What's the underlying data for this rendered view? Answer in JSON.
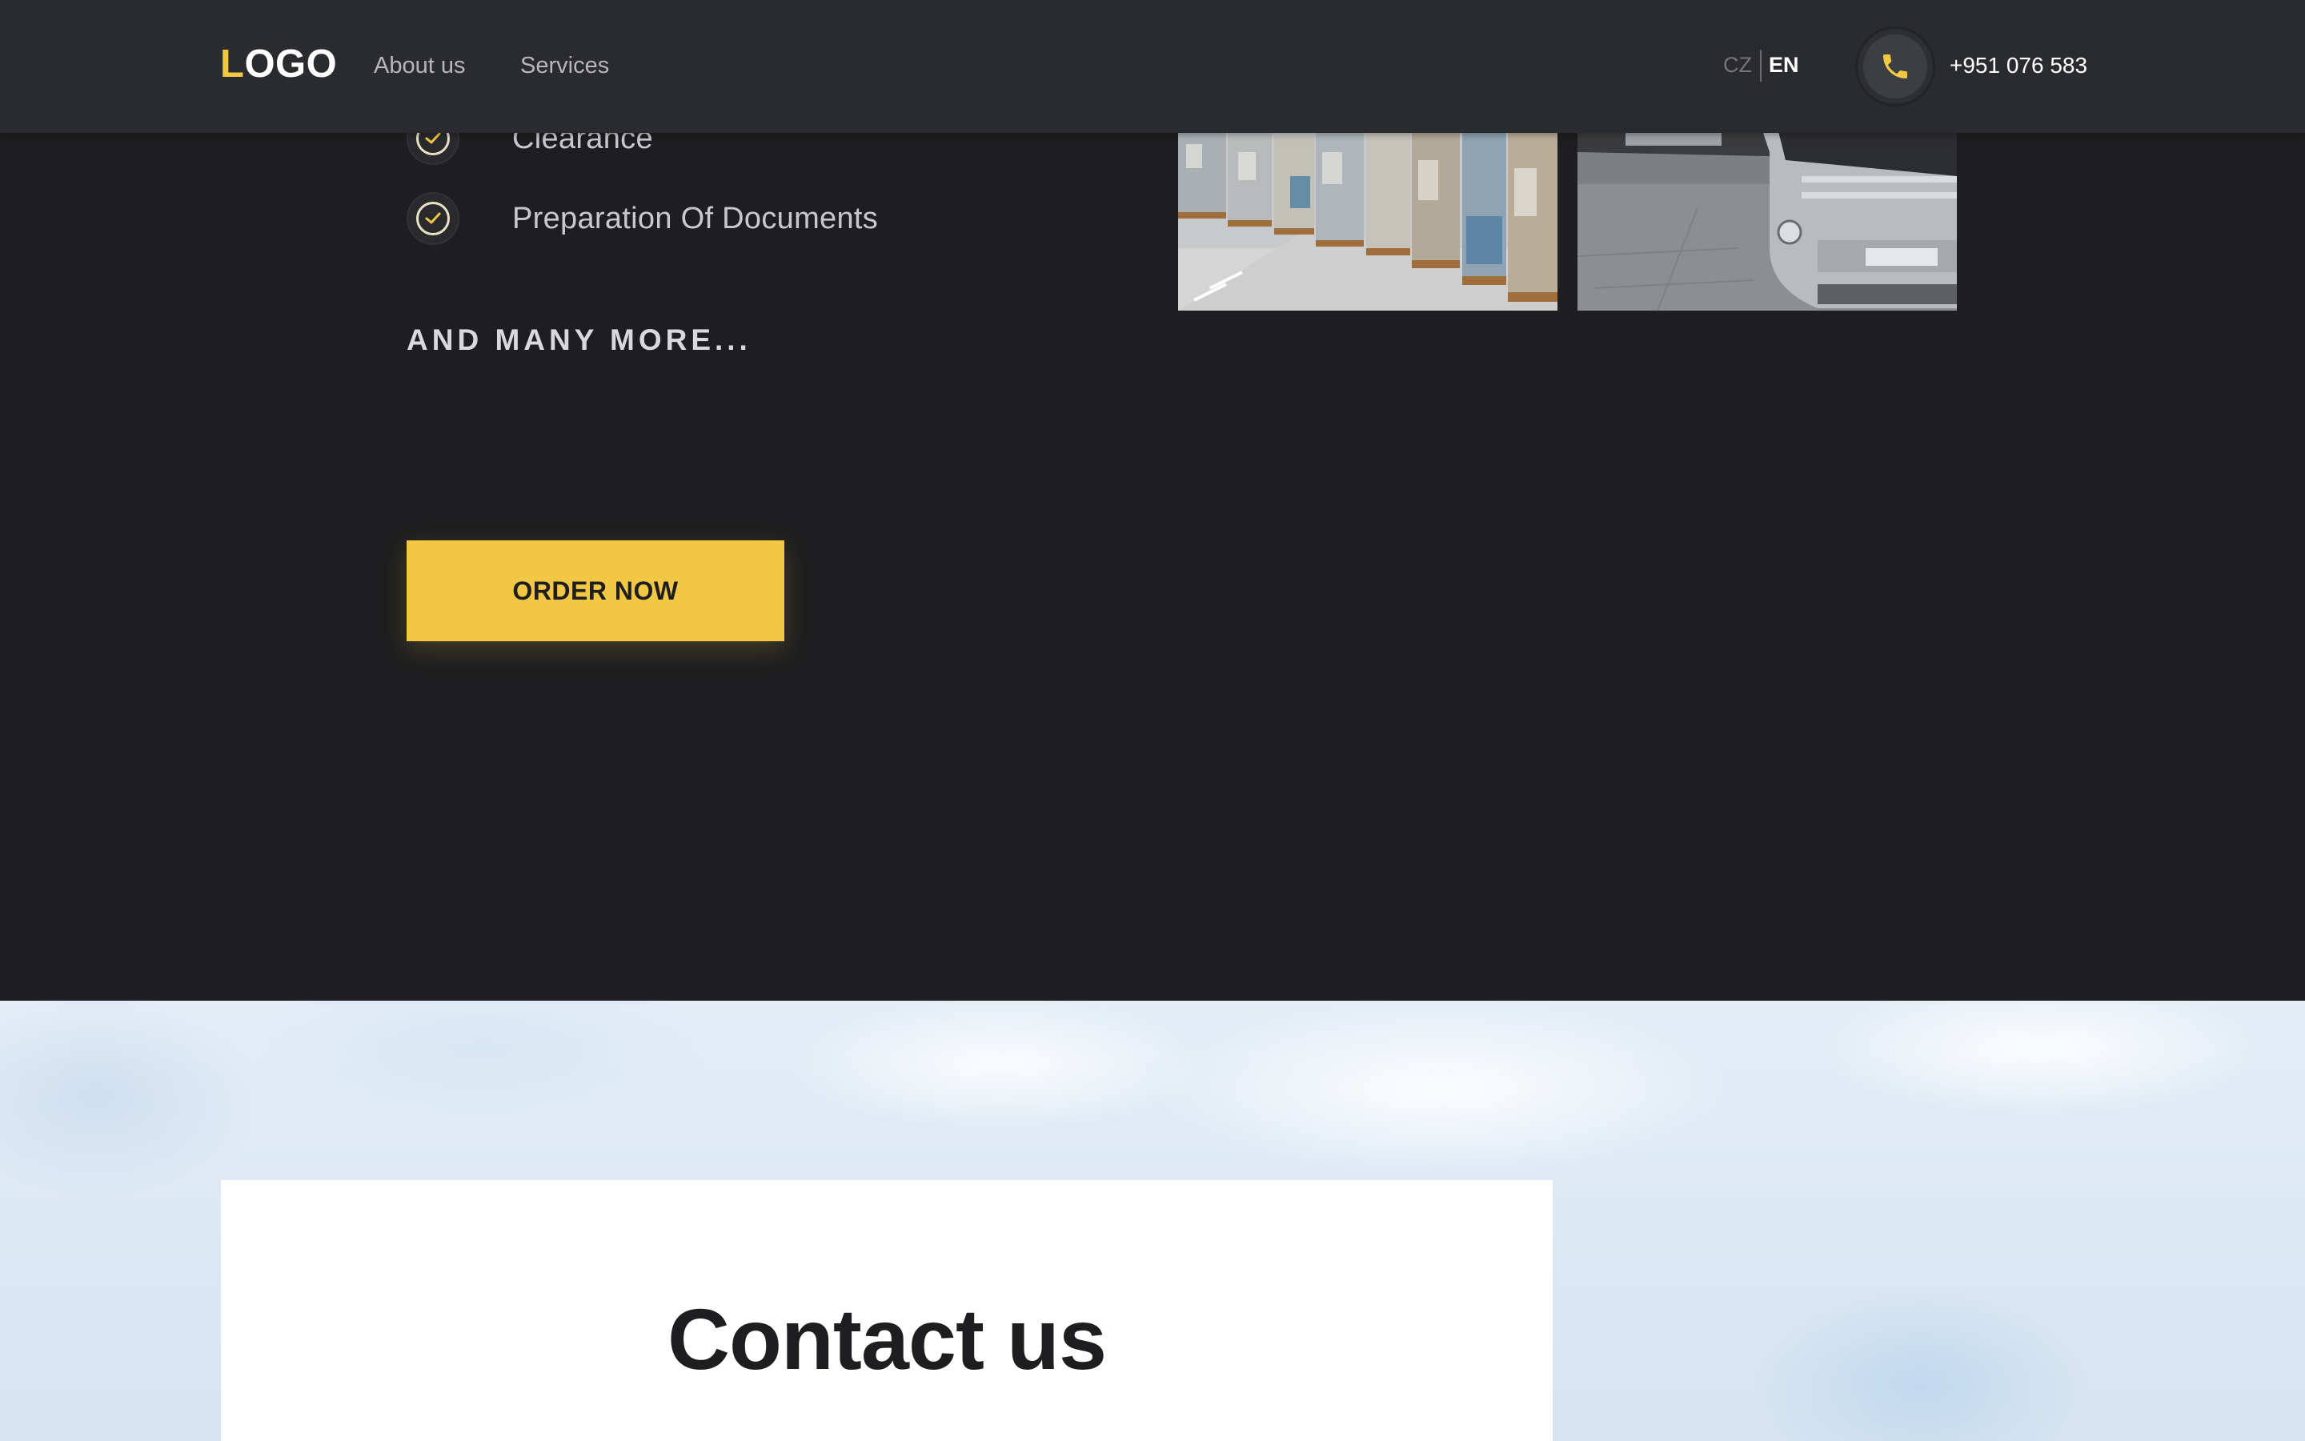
{
  "header": {
    "logo_first": "L",
    "logo_rest": "OGO",
    "nav": {
      "about": "About us",
      "services": "Services"
    },
    "lang": {
      "cz": "CZ",
      "en": "EN",
      "active": "EN"
    },
    "phone_icon": "phone-icon",
    "phone_number": "+951 076 583"
  },
  "services": {
    "features": [
      {
        "label": "Clearance",
        "icon": "check-circle-icon"
      },
      {
        "label": "Preparation Of Documents",
        "icon": "check-circle-icon"
      }
    ],
    "more_text": "AND MANY MORE...",
    "order_button": "ORDER NOW",
    "photos": [
      "warehouse-pallets-photo",
      "truck-front-photo"
    ]
  },
  "contact": {
    "title": "Contact us"
  },
  "colors": {
    "accent": "#f2c744",
    "dark_bg": "#1e1e20",
    "header_bg": "#2a2b2e",
    "contact_card": "#ffffff"
  }
}
